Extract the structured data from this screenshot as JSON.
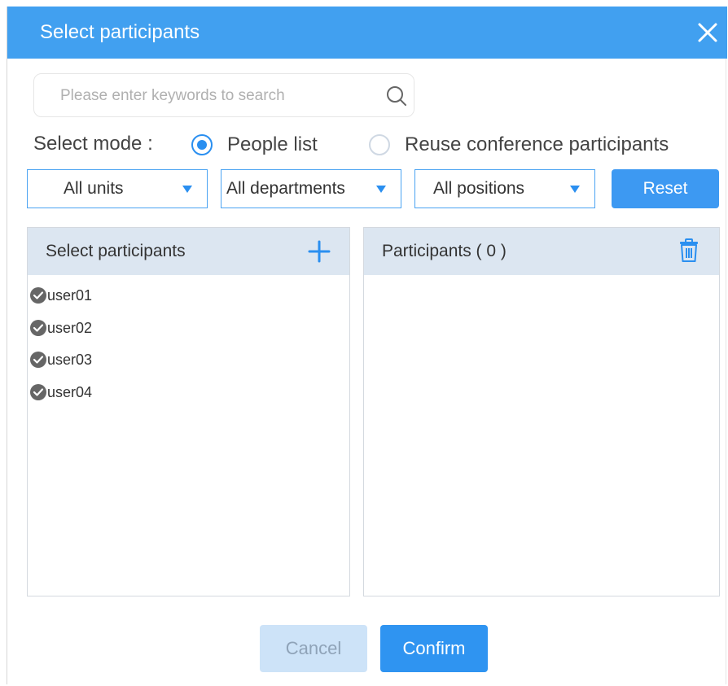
{
  "dialog": {
    "title": "Select participants",
    "close_icon": "close-icon"
  },
  "search": {
    "placeholder": "Please enter keywords to search",
    "value": "",
    "icon": "search-icon"
  },
  "mode": {
    "label": "Select mode :",
    "options": [
      {
        "label": "People list",
        "checked": true
      },
      {
        "label": "Reuse conference participants",
        "checked": false
      }
    ]
  },
  "filters": {
    "units": "All units",
    "departments": "All departments",
    "positions": "All positions",
    "reset_label": "Reset"
  },
  "left_panel": {
    "title": "Select participants",
    "add_icon": "plus-icon",
    "users": [
      "user01",
      "user02",
      "user03",
      "user04"
    ]
  },
  "right_panel": {
    "title": "Participants ( 0 )",
    "delete_icon": "trash-icon"
  },
  "footer": {
    "cancel_label": "Cancel",
    "confirm_label": "Confirm"
  },
  "colors": {
    "header_bg": "#41a0f0",
    "primary": "#2f94f1",
    "panel_header_bg": "#dce6f1",
    "disabled_button_bg": "#cde3f8"
  }
}
